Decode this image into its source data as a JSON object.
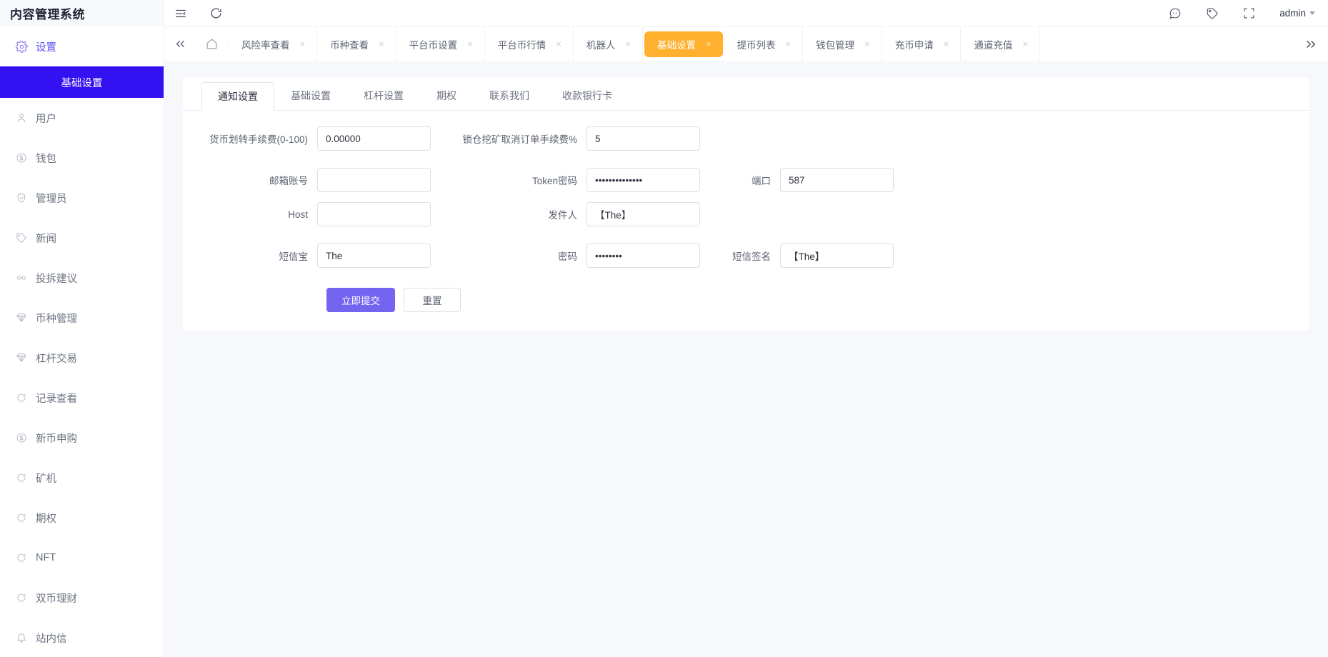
{
  "brand": {
    "title": "内容管理系统"
  },
  "topbar": {
    "menu_icon": "collapse-menu-icon",
    "refresh_icon": "refresh-icon",
    "message_icon": "message-icon",
    "tag_icon": "tag-icon",
    "fullscreen_icon": "fullscreen-icon",
    "user_label": "admin"
  },
  "tabbar": {
    "collapse_left_icon": "double-chevron-left-icon",
    "home_icon": "home-icon",
    "expand_right_icon": "double-chevron-right-icon",
    "close_glyph": "×",
    "tabs": [
      {
        "label": "风险率查看",
        "active": false
      },
      {
        "label": "币种查看",
        "active": false
      },
      {
        "label": "平台币设置",
        "active": false
      },
      {
        "label": "平台币行情",
        "active": false
      },
      {
        "label": "机器人",
        "active": false
      },
      {
        "label": "基础设置",
        "active": true
      },
      {
        "label": "提币列表",
        "active": false
      },
      {
        "label": "钱包管理",
        "active": false
      },
      {
        "label": "充币申请",
        "active": false
      },
      {
        "label": "通道充值",
        "active": false
      }
    ]
  },
  "sidebar": {
    "root": {
      "label": "设置",
      "icon": "gear-icon"
    },
    "active_sub": {
      "label": "基础设置"
    },
    "items": [
      {
        "label": "用户",
        "icon": "user-icon"
      },
      {
        "label": "钱包",
        "icon": "dollar-circle-icon"
      },
      {
        "label": "管理员",
        "icon": "shield-check-icon"
      },
      {
        "label": "新闻",
        "icon": "tag-icon"
      },
      {
        "label": "投拆建议",
        "icon": "link-icon"
      },
      {
        "label": "币种管理",
        "icon": "diamond-icon"
      },
      {
        "label": "杠杆交易",
        "icon": "diamond-icon"
      },
      {
        "label": "记录查看",
        "icon": "refresh-circle-icon"
      },
      {
        "label": "新币申购",
        "icon": "dollar-circle-icon"
      },
      {
        "label": "矿机",
        "icon": "refresh-circle-icon"
      },
      {
        "label": "期权",
        "icon": "refresh-circle-icon"
      },
      {
        "label": "NFT",
        "icon": "refresh-circle-icon"
      },
      {
        "label": "双币理财",
        "icon": "refresh-circle-icon"
      },
      {
        "label": "站内信",
        "icon": "bell-icon"
      }
    ]
  },
  "form_tabs": [
    {
      "label": "通知设置",
      "active": true
    },
    {
      "label": "基础设置",
      "active": false
    },
    {
      "label": "杠杆设置",
      "active": false
    },
    {
      "label": "期权",
      "active": false
    },
    {
      "label": "联系我们",
      "active": false
    },
    {
      "label": "收款银行卡",
      "active": false
    }
  ],
  "form": {
    "row1": {
      "transfer_fee_label": "货币划转手续费(0-100)",
      "transfer_fee_value": "0.00000",
      "cancel_fee_label": "锁仓挖矿取消订单手续费%",
      "cancel_fee_value": "5"
    },
    "row2": {
      "email_label": "邮箱账号",
      "email_value": "",
      "token_label": "Token密码",
      "token_value": "••••••••••••••",
      "port_label": "端口",
      "port_value": "587"
    },
    "row3": {
      "host_label": "Host",
      "host_value": "",
      "sender_label": "发件人",
      "sender_value": "【The】"
    },
    "row4": {
      "sms_label": "短信宝",
      "sms_value": "The",
      "password_label": "密码",
      "password_value": "••••••••",
      "sign_label": "短信签名",
      "sign_value": "【The】"
    },
    "submit_label": "立即提交",
    "reset_label": "重置"
  },
  "colors": {
    "brand_purple": "#3311f0",
    "accent_orange": "#ffb02e",
    "primary_button": "#7464f0",
    "sidebar_text": "#6b7280"
  }
}
